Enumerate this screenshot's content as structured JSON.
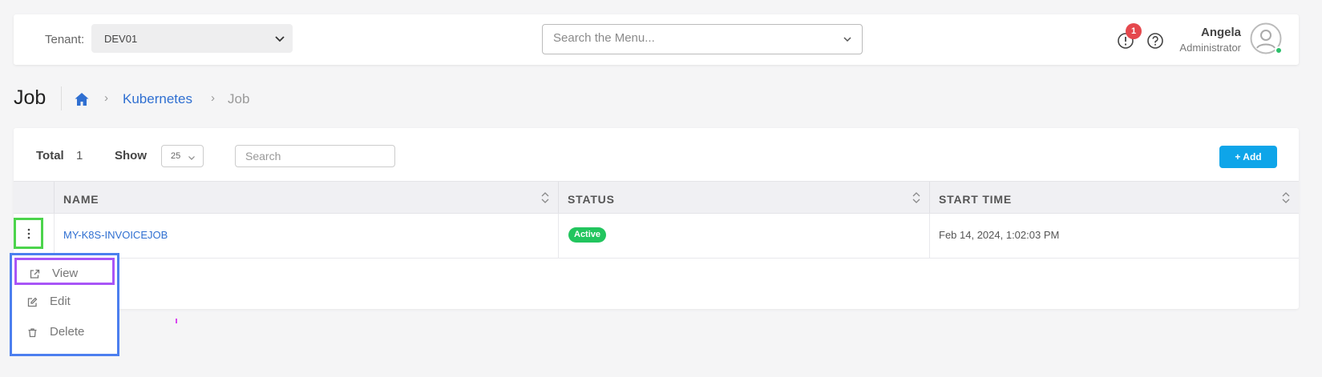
{
  "topbar": {
    "tenant_label": "Tenant:",
    "tenant_value": "DEV01",
    "menu_search_placeholder": "Search the Menu...",
    "alert_count": "1",
    "user_name": "Angela",
    "user_role": "Administrator"
  },
  "page": {
    "title": "Job",
    "breadcrumb": [
      "Kubernetes",
      "Job"
    ]
  },
  "toolbar": {
    "total_label": "Total",
    "total_count": "1",
    "show_label": "Show",
    "show_value": "25",
    "search_placeholder": "Search",
    "add_label": "+ Add"
  },
  "table": {
    "columns": [
      "NAME",
      "STATUS",
      "START TIME"
    ],
    "rows": [
      {
        "name": "MY-K8S-INVOICEJOB",
        "status": "Active",
        "start_time": "Feb 14, 2024, 1:02:03 PM"
      }
    ]
  },
  "row_menu": {
    "items": [
      {
        "label": "View",
        "icon": "external-link-icon"
      },
      {
        "label": "Edit",
        "icon": "edit-icon"
      },
      {
        "label": "Delete",
        "icon": "trash-icon"
      }
    ]
  },
  "colors": {
    "accent": "#0ea5e9",
    "link": "#2f6fd1",
    "status_active": "#22c55e",
    "alert_badge": "#e5484d"
  }
}
